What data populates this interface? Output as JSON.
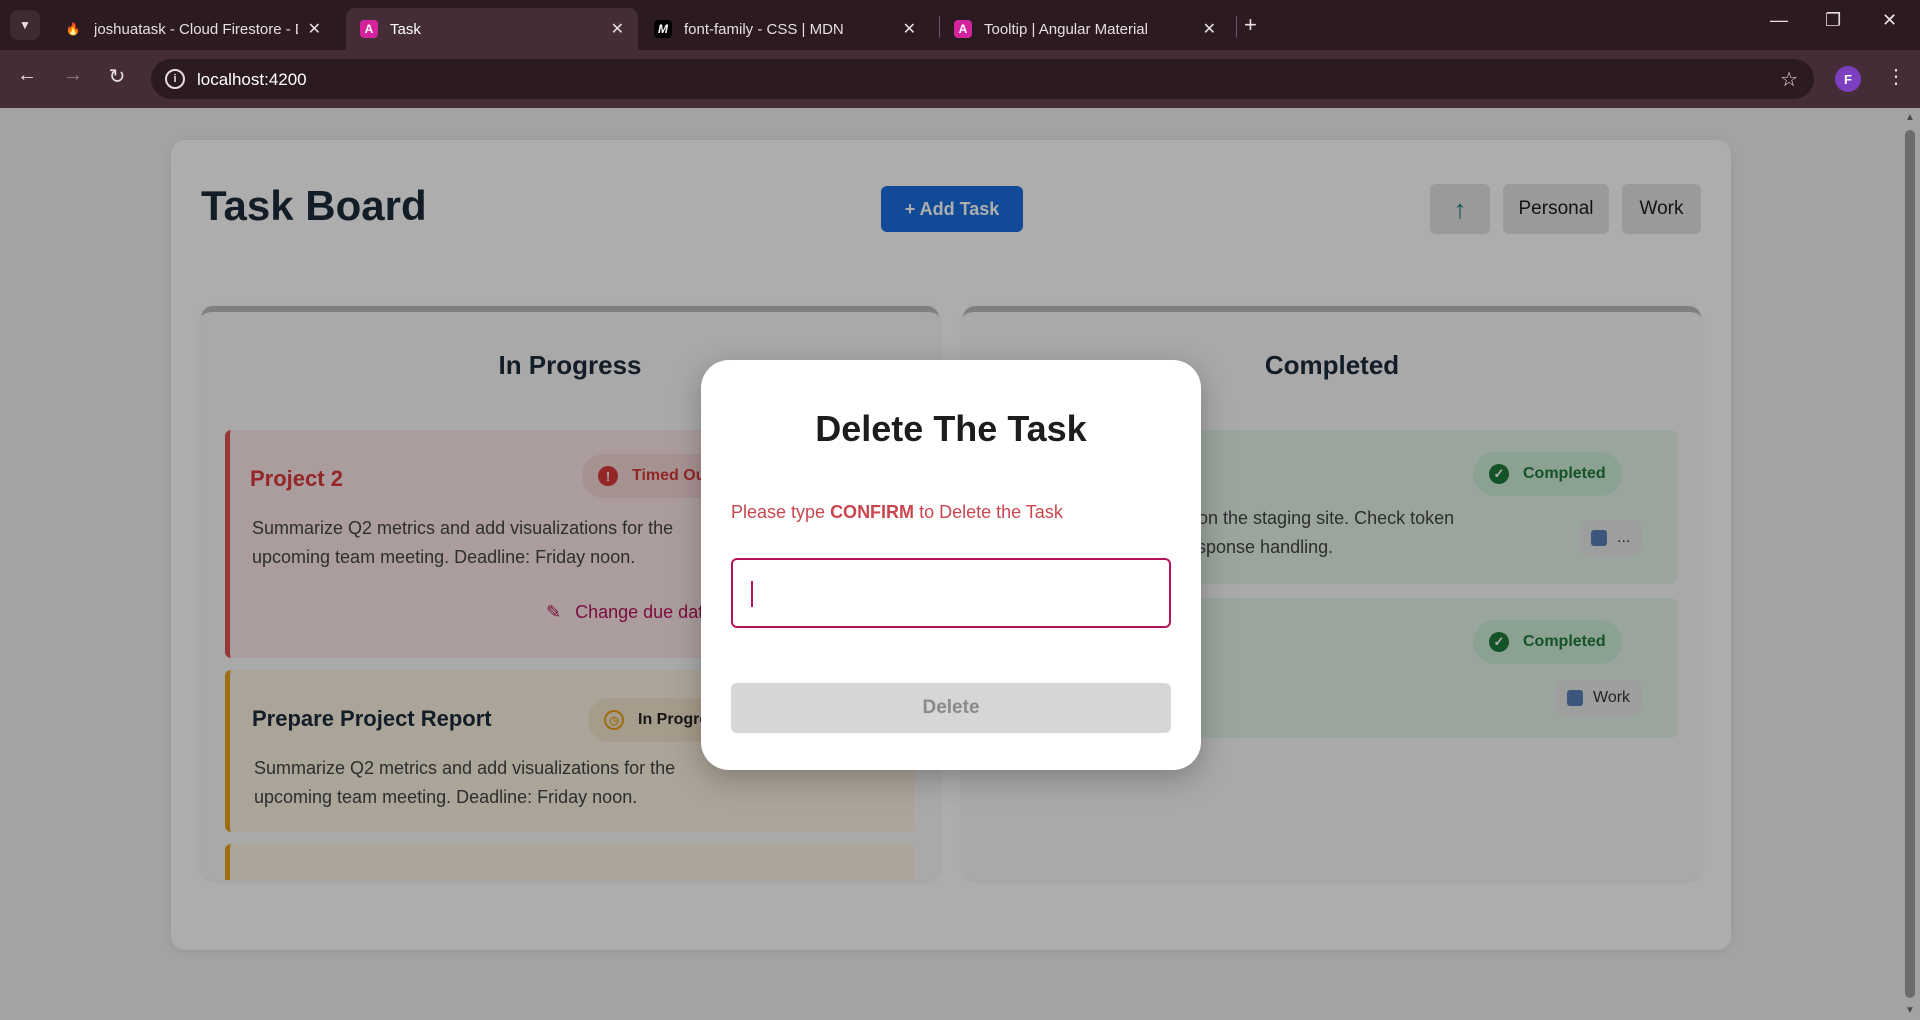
{
  "browser": {
    "tabs": [
      {
        "title": "joshuatask - Cloud Firestore - D",
        "favicon": "firebase-icon",
        "active": false
      },
      {
        "title": "Task",
        "favicon": "angular-icon",
        "active": true
      },
      {
        "title": "font-family - CSS | MDN",
        "favicon": "mdn-icon",
        "active": false
      },
      {
        "title": "Tooltip | Angular Material",
        "favicon": "angular-icon",
        "active": false
      }
    ],
    "url": "localhost:4200",
    "profile_initial": "F"
  },
  "board": {
    "title": "Task Board",
    "add_task_label": "+ Add Task",
    "filters": [
      "Personal",
      "Work"
    ]
  },
  "columns": {
    "in_progress": {
      "title": "In Progress",
      "cards": [
        {
          "title": "Project 2",
          "status": "Timed Out",
          "description_line1": "Summarize Q2 metrics and add visualizations for the",
          "description_line2": "upcoming team meeting. Deadline: Friday noon.",
          "action": "Change due date"
        },
        {
          "title": "Prepare Project Report",
          "status": "In Progress",
          "description_line1": "Summarize Q2 metrics and add visualizations for the",
          "description_line2": "upcoming team meeting. Deadline: Friday noon."
        }
      ]
    },
    "completed": {
      "title": "Completed",
      "cards": [
        {
          "status": "Completed",
          "description_line1": "r on the staging site. Check token",
          "description_line2": "esponse handling.",
          "tag": "..."
        },
        {
          "status": "Completed",
          "tag": "Work"
        }
      ]
    }
  },
  "dialog": {
    "title": "Delete The Task",
    "prompt_prefix": "Please type ",
    "prompt_keyword": "CONFIRM",
    "prompt_suffix": " to Delete the Task",
    "input_value": "",
    "delete_label": "Delete"
  },
  "colors": {
    "timed_out": "#d93838",
    "in_progress": "#e8a317",
    "completed": "#1e7a3a",
    "primary": "#1a6fe0",
    "accent": "#b4145a"
  }
}
